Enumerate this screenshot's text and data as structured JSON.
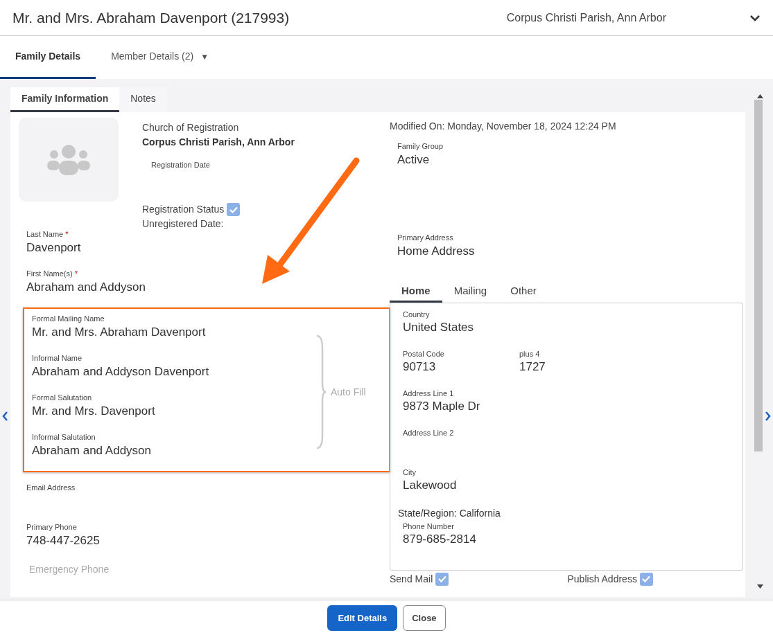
{
  "header": {
    "title": "Mr. and Mrs. Abraham Davenport (217993)",
    "parish": "Corpus Christi Parish, Ann Arbor"
  },
  "tabs": [
    {
      "label": "Family Details",
      "selected": true
    },
    {
      "label": "Member Details (2)",
      "selected": false,
      "caret": "▼"
    }
  ],
  "subtabs": [
    {
      "label": "Family Information",
      "selected": true
    },
    {
      "label": "Notes",
      "selected": false
    }
  ],
  "registration": {
    "church_label": "Church of Registration",
    "church": "Corpus Christi Parish, Ann Arbor",
    "date_label": "Registration Date",
    "status_label": "Registration Status",
    "status_checked": true,
    "unregistered_label": "Unregistered Date:"
  },
  "name_fields": [
    {
      "label": "Last Name",
      "required_mark": "*",
      "value": "Davenport"
    },
    {
      "label": "First Name(s)",
      "required_mark": "*",
      "value": "Abraham and Addyson"
    }
  ],
  "auto_fill": {
    "note": "Auto Fill",
    "fields": [
      {
        "label": "Formal Mailing Name",
        "value": "Mr. and Mrs. Abraham Davenport"
      },
      {
        "label": "Informal Name",
        "value": "Abraham and Addyson Davenport"
      },
      {
        "label": "Formal Salutation",
        "value": "Mr. and Mrs. Davenport"
      },
      {
        "label": "Informal Salutation",
        "value": "Abraham and Addyson"
      }
    ]
  },
  "contact_fields": [
    {
      "kind": "field",
      "label": "Email Address"
    },
    {
      "kind": "field",
      "label": "Primary Phone",
      "value": "748-447-2625"
    },
    {
      "kind": "input",
      "placeholder": "Emergency Phone"
    }
  ],
  "modified": "Modified On: Monday, November 18, 2024 12:24 PM",
  "right_fields": [
    {
      "label": "Family Group",
      "value": "Active"
    },
    {
      "label": "Primary Address",
      "value": "Home Address"
    }
  ],
  "address_tabs": [
    {
      "label": "Home",
      "selected": true
    },
    {
      "label": "Mailing",
      "selected": false
    },
    {
      "label": "Other",
      "selected": false
    }
  ],
  "address_rows": [
    {
      "kind": "fields",
      "fields": [
        {
          "label": "Country",
          "value": "United States"
        }
      ]
    },
    {
      "kind": "fields",
      "fields": [
        {
          "label": "Postal Code",
          "value": "90713"
        },
        {
          "label": "plus 4",
          "value": "1727"
        }
      ]
    },
    {
      "kind": "fields",
      "fields": [
        {
          "label": "Address Line 1",
          "value": "9873 Maple Dr"
        }
      ]
    },
    {
      "kind": "fields",
      "fields": [
        {
          "label": "Address Line 2"
        }
      ]
    },
    {
      "kind": "fields",
      "fields": [
        {
          "label": "City",
          "value": "Lakewood"
        }
      ]
    },
    {
      "kind": "text",
      "text": "State/Region: California"
    },
    {
      "kind": "fields",
      "fields": [
        {
          "label": "Phone Number",
          "value": "879-685-2814"
        }
      ]
    }
  ],
  "checkboxes": [
    {
      "label": "Send Mail",
      "checked": true
    },
    {
      "label": "Publish Address",
      "checked": true
    }
  ],
  "buttons": [
    {
      "label": "Edit Details",
      "kind": "primary"
    },
    {
      "label": "Close",
      "kind": "secondary"
    }
  ]
}
